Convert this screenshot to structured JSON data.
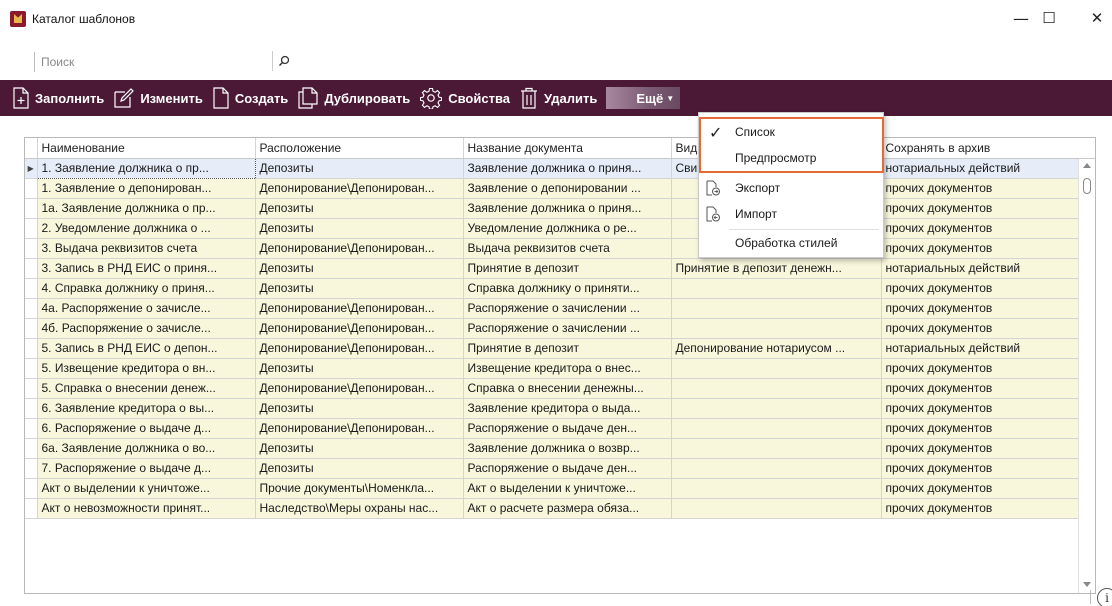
{
  "window": {
    "title": "Каталог шаблонов",
    "minimize_glyph": "—",
    "maximize_glyph": "☐",
    "close_glyph": "✕"
  },
  "search": {
    "placeholder": "Поиск",
    "value": ""
  },
  "toolbar": {
    "fill_label": "Заполнить",
    "edit_label": "Изменить",
    "create_label": "Создать",
    "duplicate_label": "Дублировать",
    "properties_label": "Свойства",
    "delete_label": "Удалить",
    "more_label": "Ещё"
  },
  "grid": {
    "columns": [
      "Наименование",
      "Расположение",
      "Название документа",
      "Вид",
      "Сохранять в архив"
    ],
    "rows": [
      [
        "1. Заявление должника о пр...",
        "Депозиты",
        "Заявление должника о приня...",
        "Сви",
        "нотариальных действий"
      ],
      [
        "1. Заявление о депонирован...",
        "Депонирование\\Депонирован...",
        "Заявление о депонировании ...",
        "",
        "прочих документов"
      ],
      [
        "1а. Заявление должника о пр...",
        "Депозиты",
        "Заявление должника о приня...",
        "",
        "прочих документов"
      ],
      [
        "2. Уведомление должника о ...",
        "Депозиты",
        "Уведомление должника о ре...",
        "",
        "прочих документов"
      ],
      [
        "3. Выдача реквизитов счета",
        "Депонирование\\Депонирован...",
        "Выдача реквизитов счета",
        "",
        "прочих документов"
      ],
      [
        "3. Запись в РНД ЕИС о приня...",
        "Депозиты",
        "Принятие в депозит",
        "Принятие в депозит денежн...",
        "нотариальных действий"
      ],
      [
        "4. Справка должнику о приня...",
        "Депозиты",
        "Справка должнику о приняти...",
        "",
        "прочих документов"
      ],
      [
        "4а. Распоряжение о зачисле...",
        "Депонирование\\Депонирован...",
        "Распоряжение о зачислении ...",
        "",
        "прочих документов"
      ],
      [
        "4б. Распоряжение о зачисле...",
        "Депонирование\\Депонирован...",
        "Распоряжение о зачислении ...",
        "",
        "прочих документов"
      ],
      [
        "5. Запись в РНД ЕИС о депон...",
        "Депонирование\\Депонирован...",
        "Принятие в депозит",
        "Депонирование нотариусом ...",
        "нотариальных действий"
      ],
      [
        "5. Извещение кредитора о вн...",
        "Депозиты",
        "Извещение кредитора о внес...",
        "",
        "прочих документов"
      ],
      [
        "5. Справка о внесении денеж...",
        "Депонирование\\Депонирован...",
        "Справка о внесении денежны...",
        "",
        "прочих документов"
      ],
      [
        "6. Заявление кредитора о вы...",
        "Депозиты",
        "Заявление кредитора о выда...",
        "",
        "прочих документов"
      ],
      [
        "6. Распоряжение о выдаче д...",
        "Депонирование\\Депонирован...",
        "Распоряжение о выдаче ден...",
        "",
        "прочих документов"
      ],
      [
        "6а. Заявление должника о во...",
        "Депозиты",
        "Заявление должника о возвр...",
        "",
        "прочих документов"
      ],
      [
        "7. Распоряжение о выдаче д...",
        "Депозиты",
        "Распоряжение о выдаче ден...",
        "",
        "прочих документов"
      ],
      [
        "Акт о выделении к уничтоже...",
        "Прочие документы\\Номенкла...",
        "Акт о выделении к уничтоже...",
        "",
        "прочих документов"
      ],
      [
        "Акт о невозможности принят...",
        "Наследство\\Меры охраны нас...",
        "Акт о расчете размера обяза...",
        "",
        "прочих документов"
      ]
    ]
  },
  "dropdown": {
    "list_label": "Список",
    "preview_label": "Предпросмотр",
    "export_label": "Экспорт",
    "import_label": "Импорт",
    "styles_label": "Обработка стилей",
    "check_glyph": "✓"
  },
  "colors": {
    "toolbar_bg": "#4b1836",
    "row_bg": "#f8f7dc",
    "highlight": "#e66a35"
  },
  "status": {
    "info_glyph": "i"
  }
}
